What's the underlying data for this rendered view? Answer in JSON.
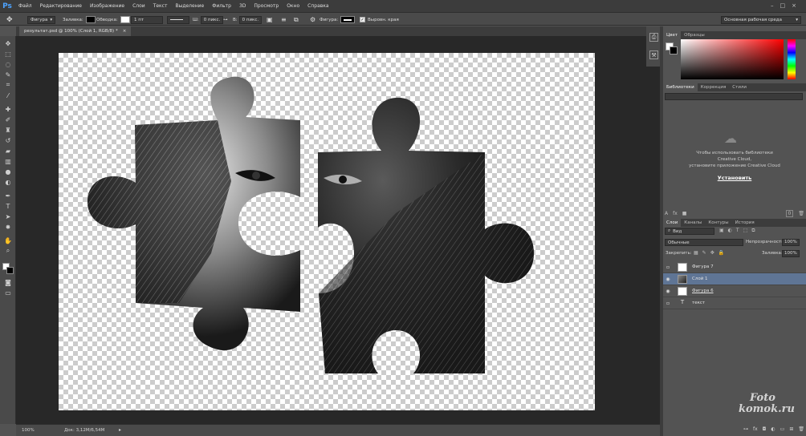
{
  "menubar": {
    "logo": "Ps",
    "items": [
      "Файл",
      "Редактирование",
      "Изображение",
      "Слои",
      "Текст",
      "Выделение",
      "Фильтр",
      "3D",
      "Просмотр",
      "Окно",
      "Справка"
    ]
  },
  "options": {
    "mode": "Фигура",
    "fill_label": "Заливка:",
    "stroke_label": "Обводка:",
    "stroke_width": "1 пт",
    "w_label": "Ш:",
    "w_value": "0 пикс.",
    "h_label": "В:",
    "h_value": "0 пикс.",
    "shape_label": "Фигура:",
    "align_edges": "Выровн. края",
    "workspace": "Основная рабочая среда"
  },
  "document": {
    "tab_title": "результат.psd @ 100% (Слой 1, RGB/8) *",
    "close": "×"
  },
  "status": {
    "zoom": "100%",
    "doc_size": "Док: 3,12M/6,54M"
  },
  "color_panel": {
    "tabs": [
      "Цвет",
      "Образцы"
    ]
  },
  "libraries_panel": {
    "tabs": [
      "Библиотеки",
      "Коррекция",
      "Стили"
    ],
    "message_line1": "Чтобы использовать библиотеки",
    "message_line2": "Creative Cloud,",
    "message_line3": "установите приложение Creative Cloud",
    "install": "Установить",
    "count": "0"
  },
  "layers_panel": {
    "tabs": [
      "Слои",
      "Каналы",
      "Контуры",
      "История"
    ],
    "filter": "Вид",
    "blend_mode": "Обычные",
    "opacity_label": "Непрозрачность:",
    "opacity_value": "100%",
    "lock_label": "Закрепить:",
    "fill_label": "Заливка:",
    "fill_value": "100%",
    "layers": [
      {
        "name": "Фигура 7",
        "visible": false
      },
      {
        "name": "Слой 1",
        "visible": true
      },
      {
        "name": "Фигура 6",
        "visible": true
      },
      {
        "name": "текст",
        "visible": false,
        "type_icon": "T"
      }
    ]
  },
  "watermark": {
    "line1": "Foto",
    "line2": "komok.ru"
  },
  "colors": {
    "accent": "#4da3ff",
    "selected_layer": "#5f7595",
    "canvas_bg": "#282828",
    "panel_bg": "#535353"
  }
}
